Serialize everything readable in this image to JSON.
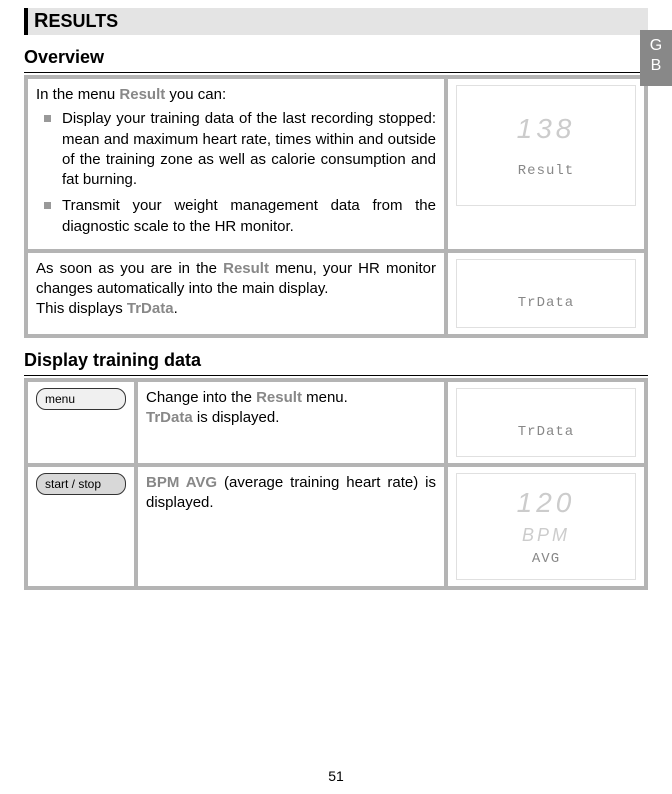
{
  "langTab": {
    "l1": "G",
    "l2": "B"
  },
  "sectionBar": {
    "accentLetter": "R",
    "rest": "ESULTS"
  },
  "overview": {
    "heading": "Overview",
    "intro_pre": "In the menu ",
    "intro_emph": "Result",
    "intro_post": " you can:",
    "li1": "Display your training data of the last recording stopped: mean and maximum heart rate, times within and outside of the training zone as well as calorie consumption and fat burning.",
    "li2": "Transmit your weight management data from the diagnostic scale to the HR monitor.",
    "p2_pre": "As soon as you are in the ",
    "p2_emph": "Result",
    "p2_mid": " menu, your HR monitor changes automatically into the main display.",
    "p2b_pre": "This displays ",
    "p2b_emph": "TrData",
    "p2b_post": ".",
    "lcd1_num": "138",
    "lcd1_text": "Result",
    "lcd2_text": "TrData"
  },
  "display": {
    "heading": "Display training data",
    "row1_btn": "menu",
    "row1_t1_pre": "Change into the ",
    "row1_t1_emph": "Result",
    "row1_t1_post": " menu.",
    "row1_t2_emph": "TrData",
    "row1_t2_post": " is displayed.",
    "row1_lcd": "TrData",
    "row2_btn": "start / stop",
    "row2_t_emph": "BPM AVG",
    "row2_t_post": " (average training heart rate) is displayed.",
    "row2_lcd_num": "120",
    "row2_lcd_unit": "bPM",
    "row2_lcd_text": "AVG"
  },
  "pageNum": "51"
}
